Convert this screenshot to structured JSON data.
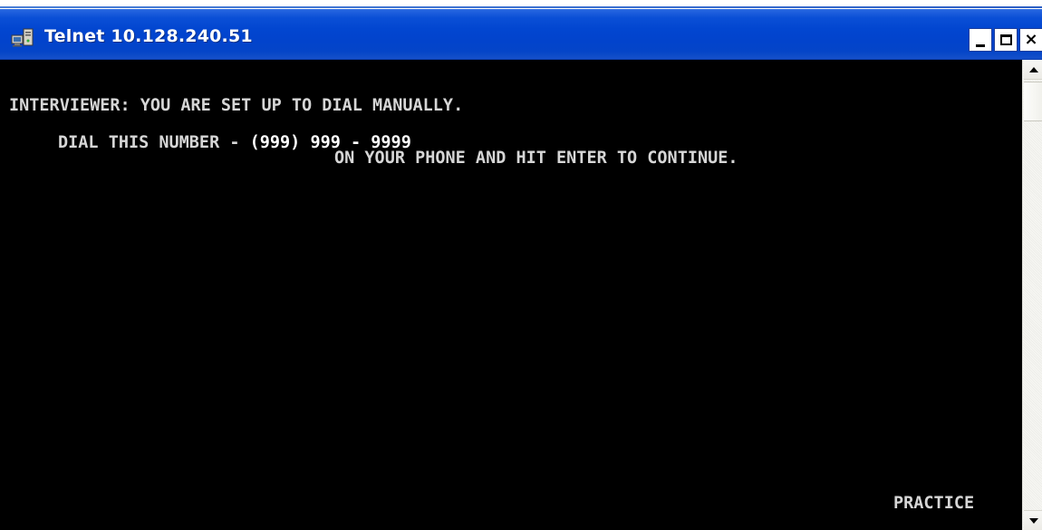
{
  "window": {
    "title": "Telnet 10.128.240.51",
    "app_icon": "telnet-computer-icon",
    "controls": {
      "minimize_icon": "minimize-icon",
      "maximize_icon": "maximize-icon",
      "close_icon": "close-icon",
      "close_glyph": "×"
    }
  },
  "terminal": {
    "line1": "INTERVIEWER: YOU ARE SET UP TO DIAL MANUALLY.",
    "line2_prefix": "DIAL THIS NUMBER - ",
    "line2_number": "(999) 999 - 9999",
    "line3": "ON YOUR PHONE AND HIT ENTER TO CONTINUE.",
    "status": "PRACTICE"
  },
  "scrollbar": {
    "up_icon": "scroll-up-arrow-icon",
    "down_icon": "scroll-down-arrow-icon"
  },
  "colors": {
    "titlebar": "#0246d0",
    "terminal_background": "#000000",
    "terminal_text": "#d6d6d6",
    "terminal_highlight": "#ffffff"
  }
}
